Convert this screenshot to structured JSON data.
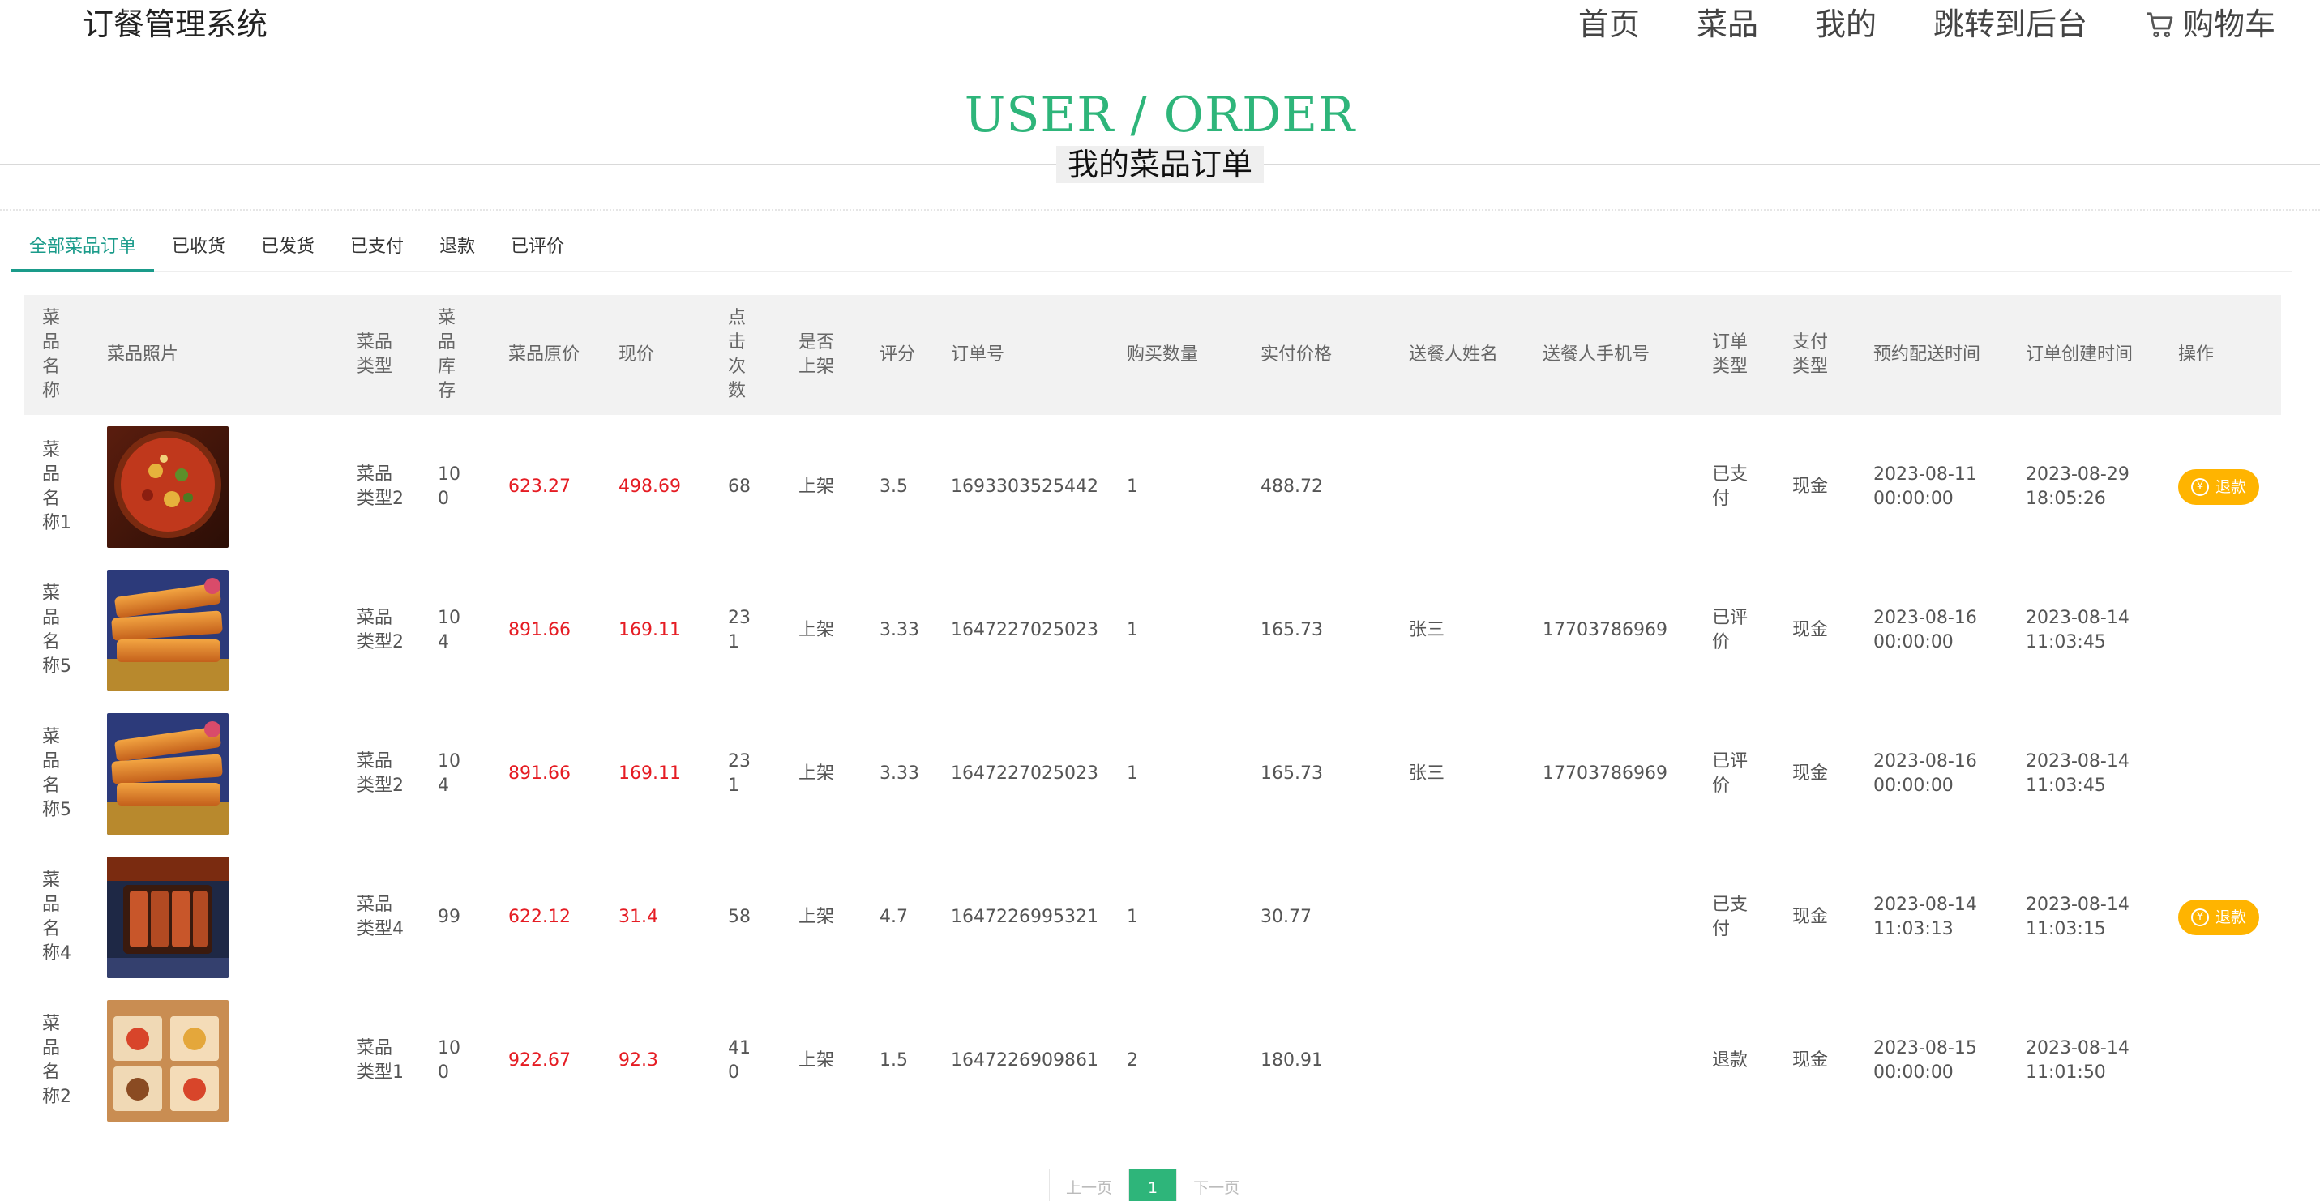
{
  "brand": "订餐管理系统",
  "nav": {
    "home": "首页",
    "dishes": "菜品",
    "mine": "我的",
    "backend": "跳转到后台",
    "cart": "购物车"
  },
  "hero": {
    "title_en": "USER / ORDER",
    "title_cn": "我的菜品订单"
  },
  "tabs": [
    {
      "label": "全部菜品订单",
      "active": true
    },
    {
      "label": "已收货"
    },
    {
      "label": "已发货"
    },
    {
      "label": "已支付"
    },
    {
      "label": "退款"
    },
    {
      "label": "已评价"
    }
  ],
  "table": {
    "headers": {
      "name": "菜品名称",
      "photo": "菜品照片",
      "type": "菜品类型",
      "stock": "菜品库存",
      "orig_price": "菜品原价",
      "cur_price": "现价",
      "clicks": "点击次数",
      "on_shelf": "是否上架",
      "score": "评分",
      "order_no": "订单号",
      "qty": "购买数量",
      "paid": "实付价格",
      "sender": "送餐人姓名",
      "sender_phone": "送餐人手机号",
      "order_type": "订单类型",
      "pay_type": "支付类型",
      "schedule": "预约配送时间",
      "created": "订单创建时间",
      "op": "操作"
    },
    "rows": [
      {
        "name": "菜品名称1",
        "photo": "pizza-photo",
        "type": "菜品类型2",
        "stock": "100",
        "orig_price": "623.27",
        "cur_price": "498.69",
        "clicks": "68",
        "on_shelf": "上架",
        "score": "3.5",
        "order_no": "1693303525442",
        "qty": "1",
        "paid": "488.72",
        "sender": "",
        "sender_phone": "",
        "order_type": "已支付",
        "pay_type": "现金",
        "schedule_date": "2023-08-11",
        "schedule_time": "00:00:00",
        "created_date": "2023-08-29",
        "created_time": "18:05:26",
        "op": "退款"
      },
      {
        "name": "菜品名称5",
        "photo": "fried-bread-photo",
        "type": "菜品类型2",
        "stock": "104",
        "orig_price": "891.66",
        "cur_price": "169.11",
        "clicks": "231",
        "on_shelf": "上架",
        "score": "3.33",
        "order_no": "1647227025023",
        "qty": "1",
        "paid": "165.73",
        "sender": "张三",
        "sender_phone": "17703786969",
        "order_type": "已评价",
        "pay_type": "现金",
        "schedule_date": "2023-08-16",
        "schedule_time": "00:00:00",
        "created_date": "2023-08-14",
        "created_time": "11:03:45",
        "op": ""
      },
      {
        "name": "菜品名称5",
        "photo": "fried-bread-photo",
        "type": "菜品类型2",
        "stock": "104",
        "orig_price": "891.66",
        "cur_price": "169.11",
        "clicks": "231",
        "on_shelf": "上架",
        "score": "3.33",
        "order_no": "1647227025023",
        "qty": "1",
        "paid": "165.73",
        "sender": "张三",
        "sender_phone": "17703786969",
        "order_type": "已评价",
        "pay_type": "现金",
        "schedule_date": "2023-08-16",
        "schedule_time": "00:00:00",
        "created_date": "2023-08-14",
        "created_time": "11:03:45",
        "op": ""
      },
      {
        "name": "菜品名称4",
        "photo": "grilled-tofu-photo",
        "type": "菜品类型4",
        "stock": "99",
        "orig_price": "622.12",
        "cur_price": "31.4",
        "clicks": "58",
        "on_shelf": "上架",
        "score": "4.7",
        "order_no": "1647226995321",
        "qty": "1",
        "paid": "30.77",
        "sender": "",
        "sender_phone": "",
        "order_type": "已支付",
        "pay_type": "现金",
        "schedule_date": "2023-08-14",
        "schedule_time": "11:03:13",
        "created_date": "2023-08-14",
        "created_time": "11:03:15",
        "op": "退款"
      },
      {
        "name": "菜品名称2",
        "photo": "dim-sum-tray-photo",
        "type": "菜品类型1",
        "stock": "100",
        "orig_price": "922.67",
        "cur_price": "92.3",
        "clicks": "410",
        "on_shelf": "上架",
        "score": "1.5",
        "order_no": "1647226909861",
        "qty": "2",
        "paid": "180.91",
        "sender": "",
        "sender_phone": "",
        "order_type": "退款",
        "pay_type": "现金",
        "schedule_date": "2023-08-15",
        "schedule_time": "00:00:00",
        "created_date": "2023-08-14",
        "created_time": "11:01:50",
        "op": ""
      }
    ]
  },
  "pager": {
    "prev": "上一页",
    "current": "1",
    "next": "下一页"
  },
  "colors": {
    "accent": "#2eb57a",
    "tab_active": "#1a9b8a",
    "price": "#e51c23",
    "refund": "#ffb400"
  },
  "icons": {
    "cart": "cart-icon",
    "refund": "yen-icon"
  }
}
